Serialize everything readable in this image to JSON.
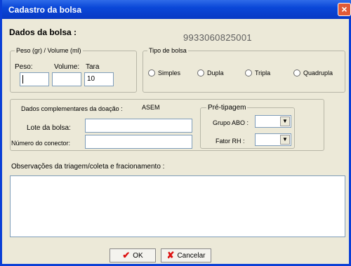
{
  "window": {
    "title": "Cadastro da bolsa",
    "close_glyph": "×"
  },
  "header": {
    "heading": "Dados da bolsa :",
    "code": "9933060825001"
  },
  "peso_group": {
    "label": "Peso (gr) / Volume (ml)",
    "peso_label": "Peso:",
    "volume_label": "Volume:",
    "tara_label": "Tara",
    "peso_value": "",
    "volume_value": "",
    "tara_value": "10"
  },
  "tipo_group": {
    "label": "Tipo de bolsa",
    "options": [
      "Simples",
      "Dupla",
      "Tripla",
      "Quadrupla"
    ]
  },
  "complementares": {
    "label": "Dados complementares da doação :",
    "source": "ASEM",
    "lote_label": "Lote da bolsa:",
    "lote_value": "",
    "conector_label": "Número do conector:",
    "conector_value": ""
  },
  "pre_tipagem": {
    "label": "Pré-tipagem",
    "grupo_label": "Grupo ABO :",
    "grupo_value": "",
    "fator_label": "Fator RH :",
    "fator_value": ""
  },
  "observacoes": {
    "label": "Observações da triagem/coleta e fracionamento :",
    "value": ""
  },
  "buttons": {
    "ok_label": "OK",
    "cancel_label": "Cancelar"
  }
}
